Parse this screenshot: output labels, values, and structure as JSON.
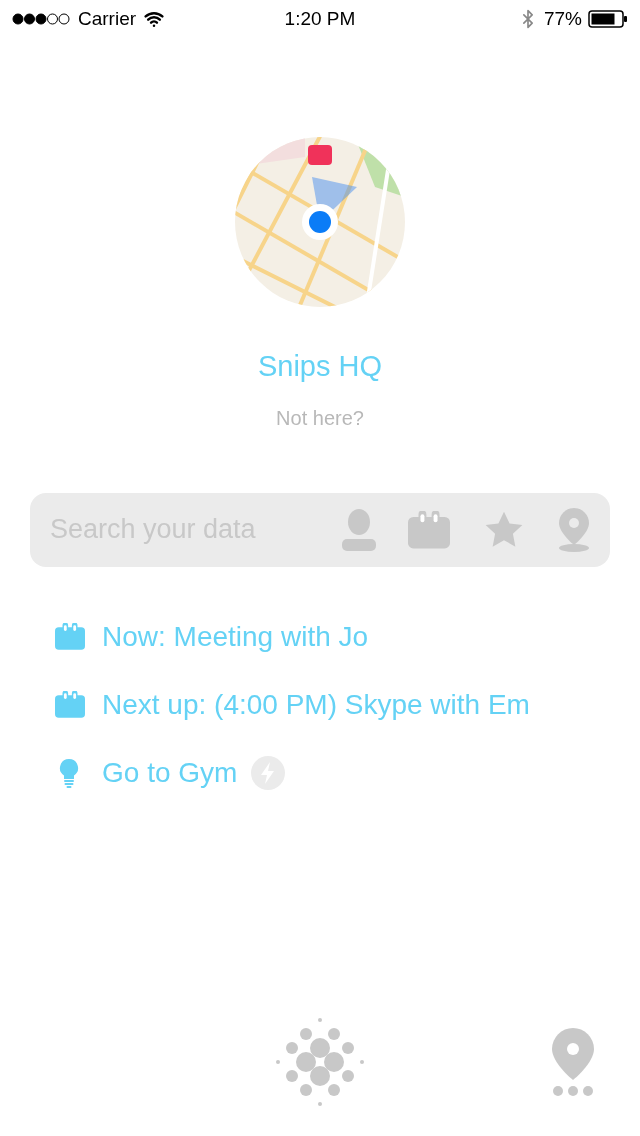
{
  "status_bar": {
    "carrier": "Carrier",
    "time": "1:20 PM",
    "battery": "77%"
  },
  "location": {
    "name": "Snips HQ",
    "link": "Not here?"
  },
  "search": {
    "placeholder": "Search your data"
  },
  "suggestions": [
    {
      "kind": "event",
      "text": "Now: Meeting with Jo",
      "lightning": false
    },
    {
      "kind": "event",
      "text": "Next up: (4:00 PM) Skype with Em",
      "lightning": false
    },
    {
      "kind": "idea",
      "text": "Go to Gym",
      "lightning": true
    }
  ]
}
